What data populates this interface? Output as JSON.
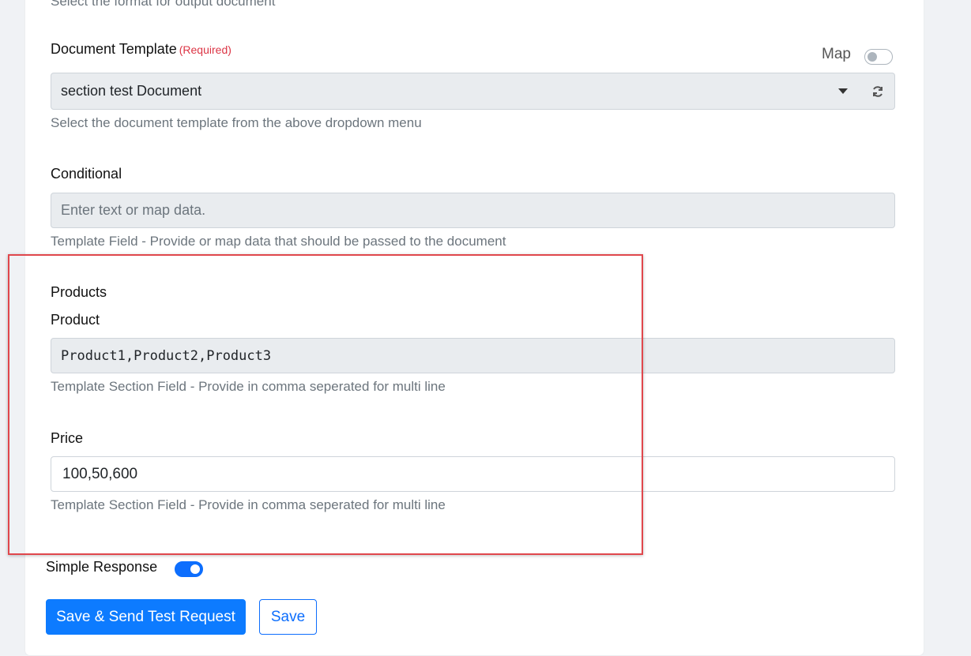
{
  "top_help": "Select the format for output document",
  "document_template": {
    "label": "Document Template",
    "required": "(Required)",
    "map_label": "Map",
    "selected": "section test Document",
    "help": "Select the document template from the above dropdown menu",
    "refresh_icon": "refresh-icon"
  },
  "conditional": {
    "label": "Conditional",
    "placeholder": "Enter text or map data.",
    "help": "Template Field - Provide or map data that should be passed to the document"
  },
  "products": {
    "section_title": "Products",
    "product": {
      "label": "Product",
      "value": "Product1,Product2,Product3",
      "help": "Template Section Field - Provide in comma seperated for multi line"
    },
    "price": {
      "label": "Price",
      "value": "100,50,600",
      "help": "Template Section Field - Provide in comma seperated for multi line"
    }
  },
  "simple_response": {
    "label": "Simple Response",
    "enabled": true
  },
  "buttons": {
    "save_send": "Save & Send Test Request",
    "save": "Save"
  },
  "colors": {
    "primary": "#0d7bff",
    "required": "#dc3545",
    "highlight": "#e0474c"
  }
}
